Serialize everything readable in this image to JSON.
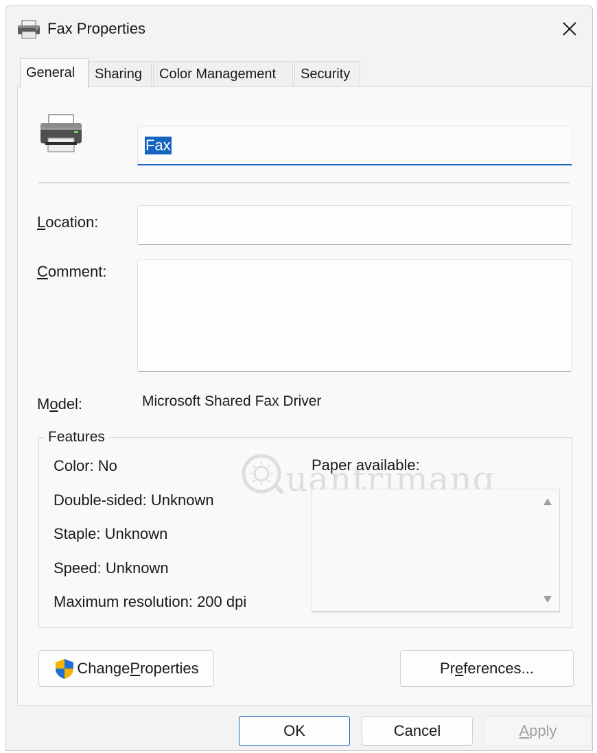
{
  "window": {
    "title": "Fax Properties"
  },
  "tabs": [
    {
      "label": "General",
      "active": true
    },
    {
      "label": "Sharing",
      "active": false
    },
    {
      "label": "Color Management",
      "active": false
    },
    {
      "label": "Security",
      "active": false
    }
  ],
  "general": {
    "printer_name": "Fax",
    "location": {
      "label_mnemonic": "L",
      "label_rest": "ocation:",
      "value": ""
    },
    "comment": {
      "label_mnemonic": "C",
      "label_rest": "omment:",
      "value": ""
    },
    "model": {
      "label_pre": "M",
      "label_mnemonic": "o",
      "label_rest": "del:",
      "value": "Microsoft Shared Fax Driver"
    },
    "features": {
      "legend": "Features",
      "items": [
        "Color: No",
        "Double-sided: Unknown",
        "Staple: Unknown",
        "Speed: Unknown",
        "Maximum resolution: 200 dpi"
      ],
      "paper_label": "Paper available:",
      "paper_items": []
    },
    "change_properties": {
      "pre": "Change ",
      "mnemonic": "P",
      "rest": "roperties"
    },
    "preferences": {
      "pre": "Pr",
      "mnemonic": "e",
      "rest": "ferences..."
    }
  },
  "footer": {
    "ok": "OK",
    "cancel": "Cancel",
    "apply_mnemonic": "A",
    "apply_rest": "pply"
  },
  "watermark_text": "uantrimang",
  "colors": {
    "accent": "#1565c0",
    "disabled_text": "#a0a0a0"
  }
}
